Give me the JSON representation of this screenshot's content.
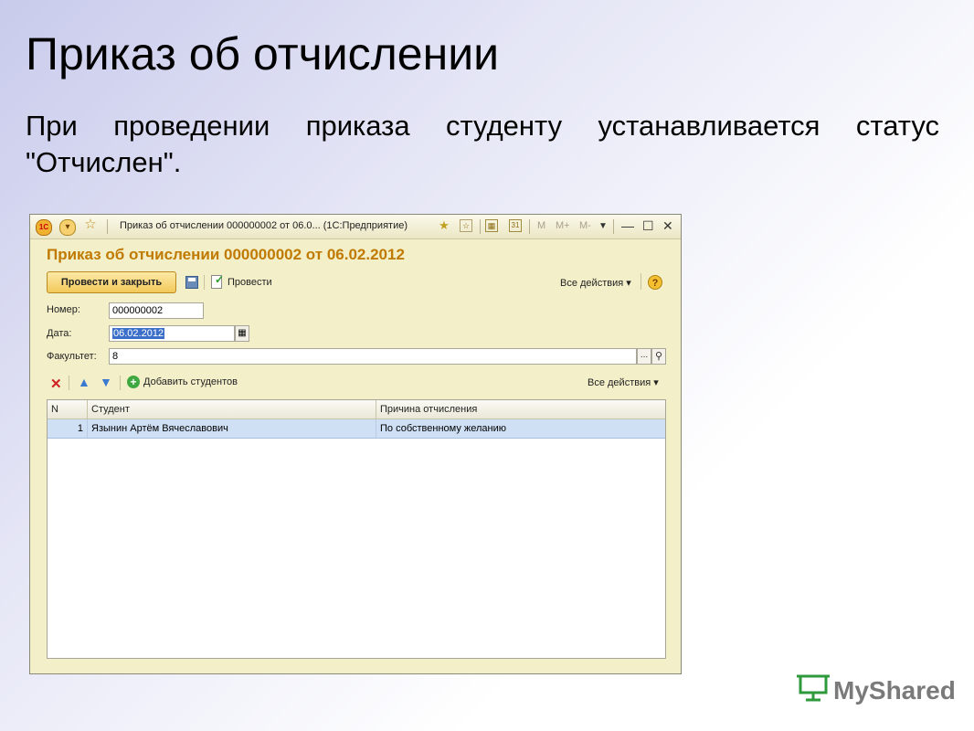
{
  "slide": {
    "title": "Приказ об отчислении",
    "text": "При проведении приказа студенту устанавливается статус \"Отчислен\"."
  },
  "window": {
    "title": "Приказ об отчислении 000000002 от 06.0...  (1С:Предприятие)",
    "toolbar_m": [
      "M",
      "M+",
      "M-"
    ]
  },
  "form": {
    "title": "Приказ об отчислении 000000002 от 06.02.2012",
    "post_close_button": "Провести и закрыть",
    "post_button": "Провести",
    "all_actions": "Все действия",
    "fields": {
      "number_label": "Номер:",
      "number_value": "000000002",
      "date_label": "Дата:",
      "date_value": "06.02.2012",
      "faculty_label": "Факультет:",
      "faculty_value": "8"
    },
    "table_toolbar": {
      "add_students": "Добавить студентов",
      "all_actions": "Все действия"
    },
    "table": {
      "columns": [
        "N",
        "Студент",
        "Причина отчисления"
      ],
      "rows": [
        {
          "n": "1",
          "student": "Язынин Артём Вячеславович",
          "reason": "По собственному желанию"
        }
      ]
    }
  },
  "brand": {
    "text": "MyShared",
    "accent": "#2e9a3c"
  }
}
